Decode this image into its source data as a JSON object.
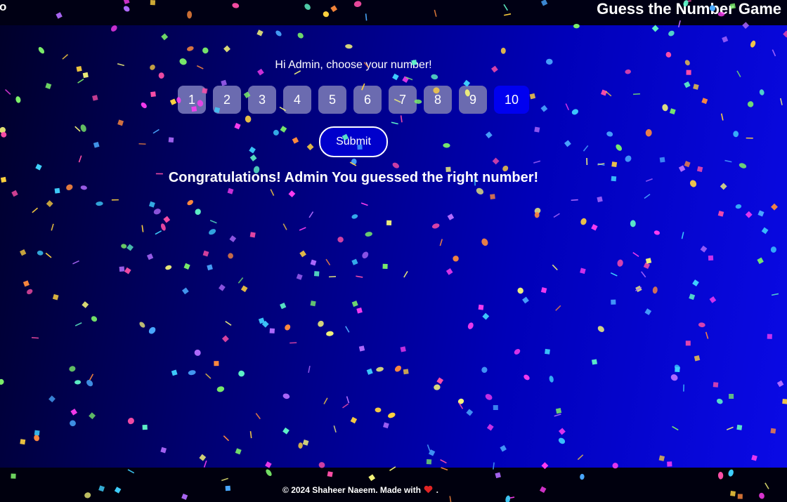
{
  "header": {
    "edge_char": "o",
    "title": "Guess the Number Game"
  },
  "game": {
    "greeting": "Hi Admin, choose your number!",
    "numbers": [
      "1",
      "2",
      "3",
      "4",
      "5",
      "6",
      "7",
      "8",
      "9",
      "10"
    ],
    "selected": "10",
    "submit_label": "Submit",
    "result": "Congratulations! Admin You guessed the right number!"
  },
  "footer": {
    "text_before": "© 2024 Shaheer Naeem. Made with",
    "heart_icon": "heart-icon",
    "text_after": "."
  },
  "colors": {
    "header_bg": "#000014",
    "button": "#6b6bb0",
    "selected_button": "#0000f0",
    "submit_bg": "#0000cc",
    "heart": "#e02424"
  }
}
